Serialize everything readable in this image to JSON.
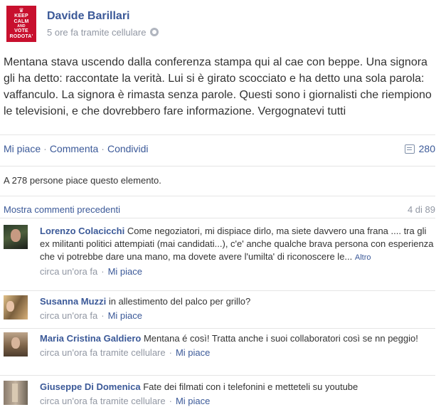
{
  "post": {
    "avatar_text": [
      "KEEP",
      "CALM",
      "AND",
      "VOTE",
      "RODOTA'"
    ],
    "author": "Davide Barillari",
    "meta": "5 ore fa tramite cellulare",
    "text": "Mentana stava uscendo dalla conferenza stampa qui al cae con beppe. Una signora gli ha detto: raccontate la verità. Lui si è girato scocciato e ha detto una sola parola: vaffanculo. La signora è rimasta senza parole. Questi sono i giornalisti che riempiono le televisioni, e che dovrebbero fare informazione. Vergognatevi tutti"
  },
  "actions": {
    "like": "Mi piace",
    "comment": "Commenta",
    "share": "Condividi",
    "comment_count": "280"
  },
  "likes_line": "A 278 persone piace questo elemento.",
  "comments_header": {
    "show_previous": "Mostra commenti precedenti",
    "page": "4 di 89"
  },
  "comments": [
    {
      "name": "Lorenzo Colacicchi",
      "text": "Come negoziatori, mi dispiace dirlo, ma siete davvero una frana .... tra gli ex militanti politici attempiati (mai candidati...), c'e' anche qualche brava persona con esperienza che vi potrebbe dare una mano, ma dovete avere l'umilta' di riconoscere le...",
      "more": "Altro",
      "time": "circa un'ora fa",
      "like": "Mi piace"
    },
    {
      "name": "Susanna Muzzi",
      "text": "in allestimento del palco per grillo?",
      "time": "circa un'ora fa",
      "like": "Mi piace"
    },
    {
      "name": "Maria Cristina Galdiero",
      "text": "Mentana é così! Tratta anche i suoi collaboratori così se nn peggio!",
      "time": "circa un'ora fa tramite cellulare",
      "like": "Mi piace"
    },
    {
      "name": "Giuseppe Di Domenica",
      "text": "Fate dei filmati con i telefonini e metteteli su youtube",
      "time": "circa un'ora fa tramite cellulare",
      "like": "Mi piace"
    }
  ]
}
